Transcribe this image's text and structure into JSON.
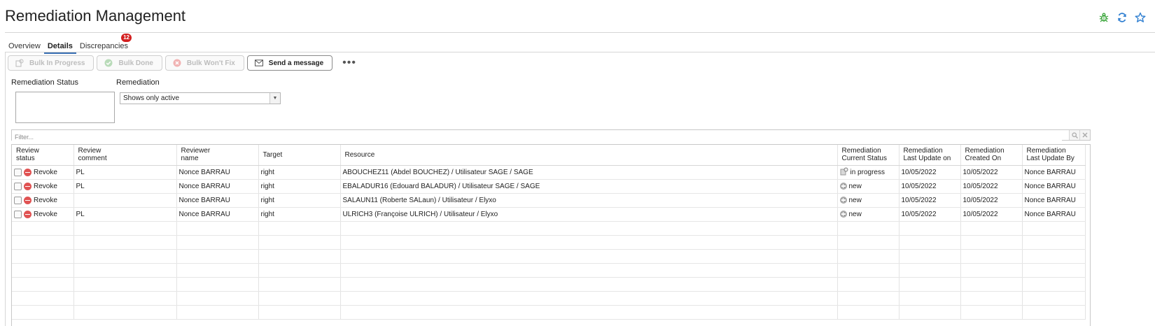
{
  "page": {
    "title": "Remediation Management"
  },
  "top_icons": [
    "bug-icon",
    "refresh-icon",
    "star-icon"
  ],
  "tabs": [
    {
      "label": "Overview",
      "active": false
    },
    {
      "label": "Details",
      "active": true
    },
    {
      "label": "Discrepancies",
      "active": false,
      "badge": "12"
    }
  ],
  "toolbar": {
    "bulk_in_progress": "Bulk In Progress",
    "bulk_done": "Bulk Done",
    "bulk_wont_fix": "Bulk Won't Fix",
    "send_message": "Send a message",
    "more": "•••"
  },
  "filters": {
    "remediation_status_label": "Remediation Status",
    "remediation_label": "Remediation",
    "remediation_value": "Shows only active",
    "filter_placeholder": "Filter..."
  },
  "table": {
    "headers": [
      [
        "Review",
        "status"
      ],
      [
        "Review",
        "comment"
      ],
      [
        "Reviewer",
        "name"
      ],
      [
        "Target",
        ""
      ],
      [
        "Resource",
        ""
      ],
      [
        "Remediation",
        "Current Status"
      ],
      [
        "Remediation",
        "Last Update on"
      ],
      [
        "Remediation",
        "Created On"
      ],
      [
        "Remediation",
        "Last Update By"
      ]
    ],
    "rows": [
      {
        "status": "Revoke",
        "comment": "PL",
        "reviewer": "Nonce BARRAU",
        "target": "right",
        "resource": "ABOUCHEZ11 (Abdel BOUCHEZ) / Utilisateur SAGE / SAGE",
        "current_status": "in progress",
        "status_icon": "in-progress",
        "last_update": "10/05/2022",
        "created_on": "10/05/2022",
        "updated_by": "Nonce BARRAU"
      },
      {
        "status": "Revoke",
        "comment": "PL",
        "reviewer": "Nonce BARRAU",
        "target": "right",
        "resource": "EBALADUR16 (Edouard BALADUR) / Utilisateur SAGE / SAGE",
        "current_status": "new",
        "status_icon": "new",
        "last_update": "10/05/2022",
        "created_on": "10/05/2022",
        "updated_by": "Nonce BARRAU"
      },
      {
        "status": "Revoke",
        "comment": "",
        "reviewer": "Nonce BARRAU",
        "target": "right",
        "resource": "SALAUN11 (Roberte SALaun) / Utilisateur / Elyxo",
        "current_status": "new",
        "status_icon": "new",
        "last_update": "10/05/2022",
        "created_on": "10/05/2022",
        "updated_by": "Nonce BARRAU"
      },
      {
        "status": "Revoke",
        "comment": "PL",
        "reviewer": "Nonce BARRAU",
        "target": "right",
        "resource": "ULRICH3 (Françoise ULRICH) / Utilisateur / Elyxo",
        "current_status": "new",
        "status_icon": "new",
        "last_update": "10/05/2022",
        "created_on": "10/05/2022",
        "updated_by": "Nonce BARRAU"
      }
    ]
  }
}
